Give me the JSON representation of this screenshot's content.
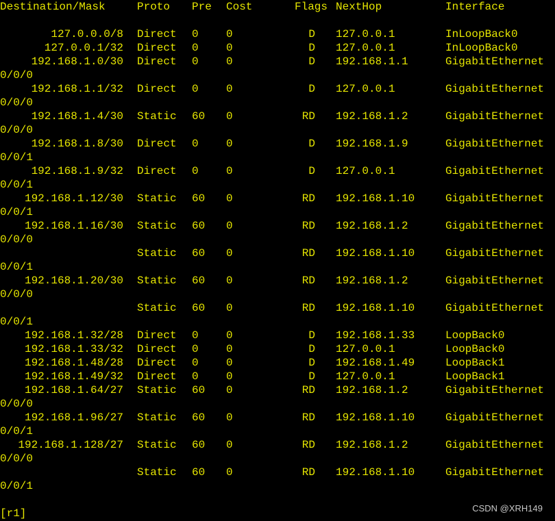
{
  "header": {
    "destination": "Destination/Mask",
    "proto": "Proto",
    "pre": "Pre",
    "cost": "Cost",
    "flags": "Flags",
    "nexthop": "NextHop",
    "interface": "Interface"
  },
  "lines": [
    {
      "kind": "blank"
    },
    {
      "kind": "route",
      "dest": "127.0.0.0/8",
      "proto": "Direct",
      "pre": "0",
      "cost": "0",
      "flags": "D",
      "nexthop": "127.0.0.1",
      "interface": "InLoopBack0"
    },
    {
      "kind": "route",
      "dest": "127.0.0.1/32",
      "proto": "Direct",
      "pre": "0",
      "cost": "0",
      "flags": "D",
      "nexthop": "127.0.0.1",
      "interface": "InLoopBack0"
    },
    {
      "kind": "route",
      "dest": "192.168.1.0/30",
      "proto": "Direct",
      "pre": "0",
      "cost": "0",
      "flags": "D",
      "nexthop": "192.168.1.1",
      "interface": "GigabitEthernet"
    },
    {
      "kind": "wrap",
      "text": "0/0/0"
    },
    {
      "kind": "route",
      "dest": "192.168.1.1/32",
      "proto": "Direct",
      "pre": "0",
      "cost": "0",
      "flags": "D",
      "nexthop": "127.0.0.1",
      "interface": "GigabitEthernet"
    },
    {
      "kind": "wrap",
      "text": "0/0/0"
    },
    {
      "kind": "route",
      "dest": "192.168.1.4/30",
      "proto": "Static",
      "pre": "60",
      "cost": "0",
      "flags": "RD",
      "nexthop": "192.168.1.2",
      "interface": "GigabitEthernet"
    },
    {
      "kind": "wrap",
      "text": "0/0/0"
    },
    {
      "kind": "route",
      "dest": "192.168.1.8/30",
      "proto": "Direct",
      "pre": "0",
      "cost": "0",
      "flags": "D",
      "nexthop": "192.168.1.9",
      "interface": "GigabitEthernet"
    },
    {
      "kind": "wrap",
      "text": "0/0/1"
    },
    {
      "kind": "route",
      "dest": "192.168.1.9/32",
      "proto": "Direct",
      "pre": "0",
      "cost": "0",
      "flags": "D",
      "nexthop": "127.0.0.1",
      "interface": "GigabitEthernet"
    },
    {
      "kind": "wrap",
      "text": "0/0/1"
    },
    {
      "kind": "route",
      "dest": "192.168.1.12/30",
      "proto": "Static",
      "pre": "60",
      "cost": "0",
      "flags": "RD",
      "nexthop": "192.168.1.10",
      "interface": "GigabitEthernet"
    },
    {
      "kind": "wrap",
      "text": "0/0/1"
    },
    {
      "kind": "route",
      "dest": "192.168.1.16/30",
      "proto": "Static",
      "pre": "60",
      "cost": "0",
      "flags": "RD",
      "nexthop": "192.168.1.2",
      "interface": "GigabitEthernet"
    },
    {
      "kind": "wrap",
      "text": "0/0/0"
    },
    {
      "kind": "route",
      "dest": "",
      "proto": "Static",
      "pre": "60",
      "cost": "0",
      "flags": "RD",
      "nexthop": "192.168.1.10",
      "interface": "GigabitEthernet"
    },
    {
      "kind": "wrap",
      "text": "0/0/1"
    },
    {
      "kind": "route",
      "dest": "192.168.1.20/30",
      "proto": "Static",
      "pre": "60",
      "cost": "0",
      "flags": "RD",
      "nexthop": "192.168.1.2",
      "interface": "GigabitEthernet"
    },
    {
      "kind": "wrap",
      "text": "0/0/0"
    },
    {
      "kind": "route",
      "dest": "",
      "proto": "Static",
      "pre": "60",
      "cost": "0",
      "flags": "RD",
      "nexthop": "192.168.1.10",
      "interface": "GigabitEthernet"
    },
    {
      "kind": "wrap",
      "text": "0/0/1"
    },
    {
      "kind": "route",
      "dest": "192.168.1.32/28",
      "proto": "Direct",
      "pre": "0",
      "cost": "0",
      "flags": "D",
      "nexthop": "192.168.1.33",
      "interface": "LoopBack0"
    },
    {
      "kind": "route",
      "dest": "192.168.1.33/32",
      "proto": "Direct",
      "pre": "0",
      "cost": "0",
      "flags": "D",
      "nexthop": "127.0.0.1",
      "interface": "LoopBack0"
    },
    {
      "kind": "route",
      "dest": "192.168.1.48/28",
      "proto": "Direct",
      "pre": "0",
      "cost": "0",
      "flags": "D",
      "nexthop": "192.168.1.49",
      "interface": "LoopBack1"
    },
    {
      "kind": "route",
      "dest": "192.168.1.49/32",
      "proto": "Direct",
      "pre": "0",
      "cost": "0",
      "flags": "D",
      "nexthop": "127.0.0.1",
      "interface": "LoopBack1"
    },
    {
      "kind": "route",
      "dest": "192.168.1.64/27",
      "proto": "Static",
      "pre": "60",
      "cost": "0",
      "flags": "RD",
      "nexthop": "192.168.1.2",
      "interface": "GigabitEthernet"
    },
    {
      "kind": "wrap",
      "text": "0/0/0"
    },
    {
      "kind": "route",
      "dest": "192.168.1.96/27",
      "proto": "Static",
      "pre": "60",
      "cost": "0",
      "flags": "RD",
      "nexthop": "192.168.1.10",
      "interface": "GigabitEthernet"
    },
    {
      "kind": "wrap",
      "text": "0/0/1"
    },
    {
      "kind": "route",
      "dest": "192.168.1.128/27",
      "proto": "Static",
      "pre": "60",
      "cost": "0",
      "flags": "RD",
      "nexthop": "192.168.1.2",
      "interface": "GigabitEthernet"
    },
    {
      "kind": "wrap",
      "text": "0/0/0"
    },
    {
      "kind": "route",
      "dest": "",
      "proto": "Static",
      "pre": "60",
      "cost": "0",
      "flags": "RD",
      "nexthop": "192.168.1.10",
      "interface": "GigabitEthernet"
    },
    {
      "kind": "wrap",
      "text": "0/0/1"
    },
    {
      "kind": "blank"
    }
  ],
  "prompt": "[r1]",
  "watermark": "CSDN @XRH149",
  "colors": {
    "background": "#000000",
    "text": "#e6e600"
  }
}
